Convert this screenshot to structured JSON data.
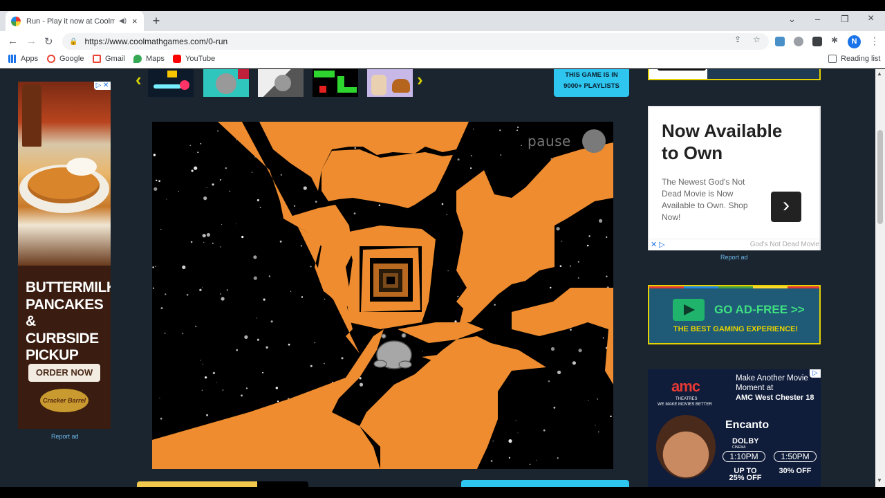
{
  "browser": {
    "tab": {
      "title": "Run - Play it now at Coolmat",
      "audio_icon": "speaker-icon",
      "close_glyph": "×"
    },
    "new_tab_glyph": "+",
    "window_controls": {
      "dropdown": "⌄",
      "minimize": "–",
      "restore": "❐",
      "close": "×"
    },
    "nav": {
      "back": "←",
      "forward": "→",
      "reload": "↻"
    },
    "url": "https://www.coolmathgames.com/0-run",
    "profile_initial": "N",
    "menu_glyph": "⋮",
    "bookmarks": [
      {
        "label": "Apps",
        "color": "#1a73e8"
      },
      {
        "label": "Google",
        "color": "#ea4335"
      },
      {
        "label": "Gmail",
        "color": "#ea4335"
      },
      {
        "label": "Maps",
        "color": "#34a853"
      },
      {
        "label": "YouTube",
        "color": "#ff0000"
      }
    ],
    "reading_list": "Reading list"
  },
  "carousel": {
    "prev_glyph": "‹",
    "next_glyph": "›",
    "playlist_badge": {
      "line1": "THIS GAME IS IN",
      "line2": "9000+ PLAYLISTS"
    }
  },
  "game": {
    "title": "Run",
    "pause_label": "pause"
  },
  "left_ad": {
    "headline": "BUTTERMILK PANCAKES & CURBSIDE PICKUP",
    "cta": "ORDER NOW",
    "brand": "Cracker Barrel",
    "report": "Report ad"
  },
  "right_ad": {
    "title": "Now Available to Own",
    "body": "The Newest God's Not Dead Movie is Now Available to Own. Shop Now!",
    "arrow": "›",
    "advertiser": "God's Not Dead Movie",
    "report": "Report ad"
  },
  "adfree": {
    "title": "GO AD-FREE >>",
    "subtitle": "THE BEST GAMING EXPERIENCE!"
  },
  "amc_ad": {
    "logo": "amc",
    "logo_sub": "THEATRES",
    "tagline_sub": "WE MAKE MOVIES BETTER",
    "tag1": "Make Another Movie Moment at",
    "tag2": "AMC West Chester 18",
    "movie": "Encanto",
    "format": "DOLBY",
    "format_sub": "CINEMA",
    "times": [
      "1:10PM",
      "1:50PM"
    ],
    "offer1": "UP TO 25% OFF",
    "offer2": "30% OFF"
  },
  "colors": {
    "page_bg": "#1a2530",
    "accent_blue": "#2ec5ef",
    "accent_yellow": "#e6d200",
    "game_orange": "#ee8c2f"
  }
}
